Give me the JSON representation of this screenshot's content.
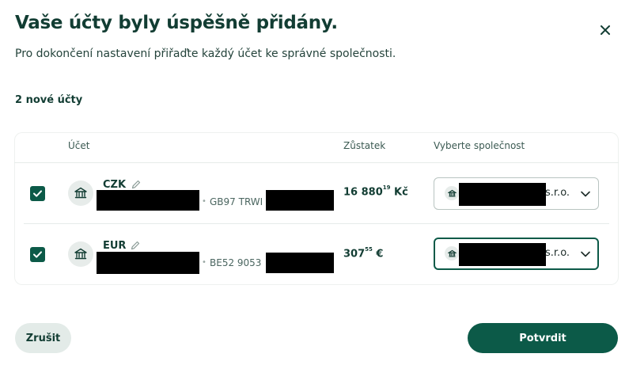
{
  "dialog": {
    "title": "Vaše účty byly úspěšně přidány.",
    "subtitle": "Pro dokončení nastavení přiřaďte každý účet ke správné společnosti.",
    "new_accounts_count": "2 nové účty"
  },
  "table": {
    "headers": {
      "account": "Účet",
      "balance": "Zůstatek",
      "company": "Vyberte společnost"
    },
    "rows": [
      {
        "checked": true,
        "currency": "CZK",
        "separator": "•",
        "iban_prefix": "GB97 TRWI",
        "balance_int": "16 880",
        "balance_dec": "19",
        "balance_unit": "Kč",
        "company_suffix": "s.r.o."
      },
      {
        "checked": true,
        "currency": "EUR",
        "separator": "•",
        "iban_prefix": "BE52 9053",
        "balance_int": "307",
        "balance_dec": "55",
        "balance_unit": "€",
        "company_suffix": "s.r.o."
      }
    ]
  },
  "buttons": {
    "cancel": "Zrušit",
    "confirm": "Potvrdit"
  },
  "icons": {
    "close": "close-icon",
    "bank": "bank-icon",
    "pencil": "pencil-icon",
    "check": "check-icon",
    "chevron": "chevron-down-icon"
  },
  "colors": {
    "primary": "#0c5a48",
    "title": "#123d33",
    "cancel_bg": "#e3ebe8"
  }
}
